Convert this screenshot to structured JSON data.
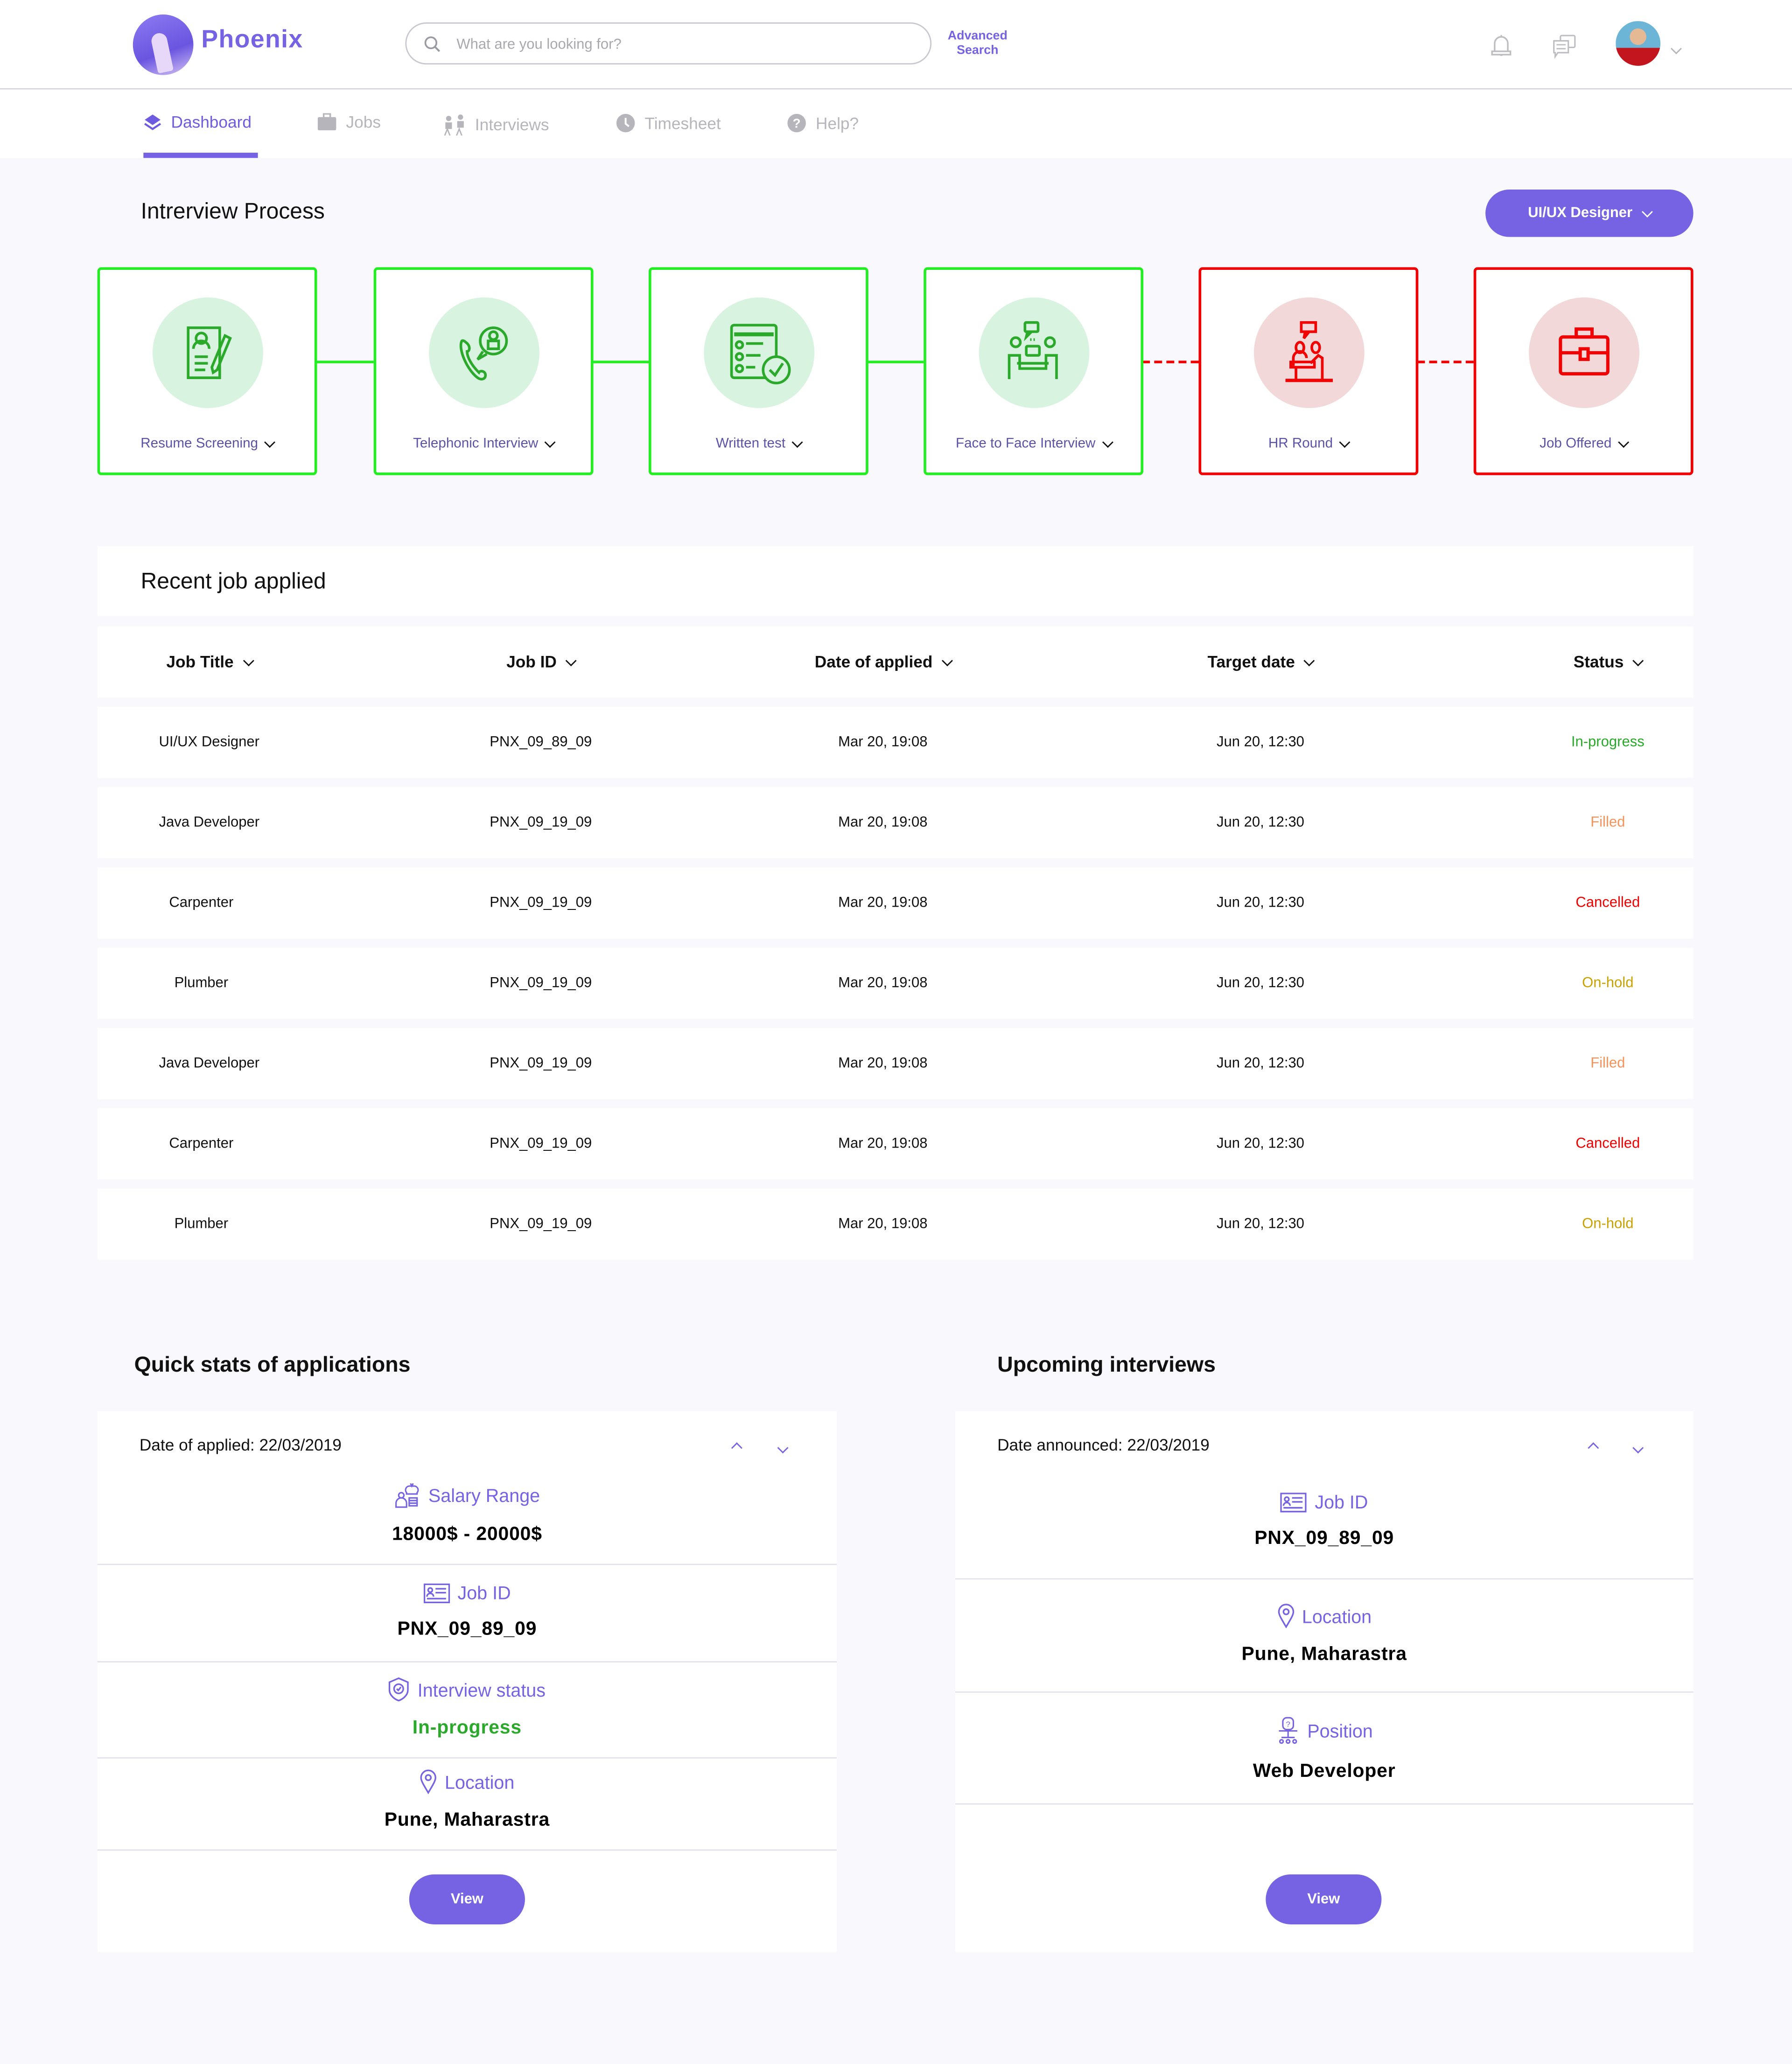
{
  "header": {
    "brand": "Phoenix",
    "search_placeholder": "What are you looking for?",
    "advanced_search": "Advanced Search",
    "icons": [
      "bell-icon",
      "chat-icon",
      "avatar",
      "chevron-down-icon"
    ]
  },
  "nav": {
    "items": [
      {
        "label": "Dashboard",
        "icon": "layers-icon",
        "active": true
      },
      {
        "label": "Jobs",
        "icon": "briefcase-icon",
        "active": false
      },
      {
        "label": "Interviews",
        "icon": "people-icon",
        "active": false
      },
      {
        "label": "Timesheet",
        "icon": "clock-icon",
        "active": false
      },
      {
        "label": "Help?",
        "icon": "question-icon",
        "active": false
      }
    ]
  },
  "process": {
    "title": "Intrerview Process",
    "role_selector": "UI/UX Designer",
    "steps": [
      {
        "label": "Resume Screening",
        "icon": "resume-icon",
        "state": "completed"
      },
      {
        "label": "Telephonic Interview",
        "icon": "phone-call-icon",
        "state": "completed"
      },
      {
        "label": "Written test",
        "icon": "checklist-icon",
        "state": "completed"
      },
      {
        "label": "Face to Face Interview",
        "icon": "meeting-icon",
        "state": "completed"
      },
      {
        "label": "HR Round",
        "icon": "hr-desk-icon",
        "state": "pending"
      },
      {
        "label": "Job Offered",
        "icon": "briefcase-icon",
        "state": "pending"
      }
    ],
    "colors": {
      "completed": "#22ee22",
      "pending": "#f00000"
    }
  },
  "recent_jobs": {
    "title": "Recent job applied",
    "columns": [
      "Job Title",
      "Job ID",
      "Date of applied",
      "Target date",
      "Status"
    ],
    "rows": [
      {
        "title": "UI/UX Designer",
        "id": "PNX_09_89_09",
        "applied": "Mar 20, 19:08",
        "target": "Jun 20, 12:30",
        "status": "In-progress"
      },
      {
        "title": "Java Developer",
        "id": "PNX_09_19_09",
        "applied": "Mar 20, 19:08",
        "target": "Jun 20, 12:30",
        "status": "Filled"
      },
      {
        "title": "Carpenter",
        "id": "PNX_09_19_09",
        "applied": "Mar 20, 19:08",
        "target": "Jun 20, 12:30",
        "status": "Cancelled"
      },
      {
        "title": "Plumber",
        "id": "PNX_09_19_09",
        "applied": "Mar 20, 19:08",
        "target": "Jun 20, 12:30",
        "status": "On-hold"
      },
      {
        "title": "Java Developer",
        "id": "PNX_09_19_09",
        "applied": "Mar 20, 19:08",
        "target": "Jun 20, 12:30",
        "status": "Filled"
      },
      {
        "title": "Carpenter",
        "id": "PNX_09_19_09",
        "applied": "Mar 20, 19:08",
        "target": "Jun 20, 12:30",
        "status": "Cancelled"
      },
      {
        "title": "Plumber",
        "id": "PNX_09_19_09",
        "applied": "Mar 20, 19:08",
        "target": "Jun 20, 12:30",
        "status": "On-hold"
      }
    ],
    "status_colors": {
      "In-progress": "#2aa92a",
      "Filled": "#f5945a",
      "Cancelled": "#f00000",
      "On-hold": "#c9a100"
    }
  },
  "quick_stats": {
    "title": "Quick stats of applications",
    "date_line": "Date of applied: 22/03/2019",
    "fields": [
      {
        "label": "Salary Range",
        "icon": "salary-icon",
        "value": "18000$ - 20000$"
      },
      {
        "label": "Job ID",
        "icon": "id-card-icon",
        "value": "PNX_09_89_09"
      },
      {
        "label": "Interview status",
        "icon": "shield-check-icon",
        "value": "In-progress",
        "value_color": "#2aa92a"
      },
      {
        "label": "Location",
        "icon": "location-pin-icon",
        "value": "Pune, Maharastra"
      }
    ],
    "button": "View"
  },
  "upcoming": {
    "title": "Upcoming interviews",
    "date_line": "Date announced: 22/03/2019",
    "fields": [
      {
        "label": "Job ID",
        "icon": "id-card-icon",
        "value": "PNX_09_89_09"
      },
      {
        "label": "Location",
        "icon": "location-pin-icon",
        "value": "Pune, Maharastra"
      },
      {
        "label": "Position",
        "icon": "chair-icon",
        "value": "Web Developer"
      }
    ],
    "button": "View"
  },
  "accent": "#7663e3"
}
